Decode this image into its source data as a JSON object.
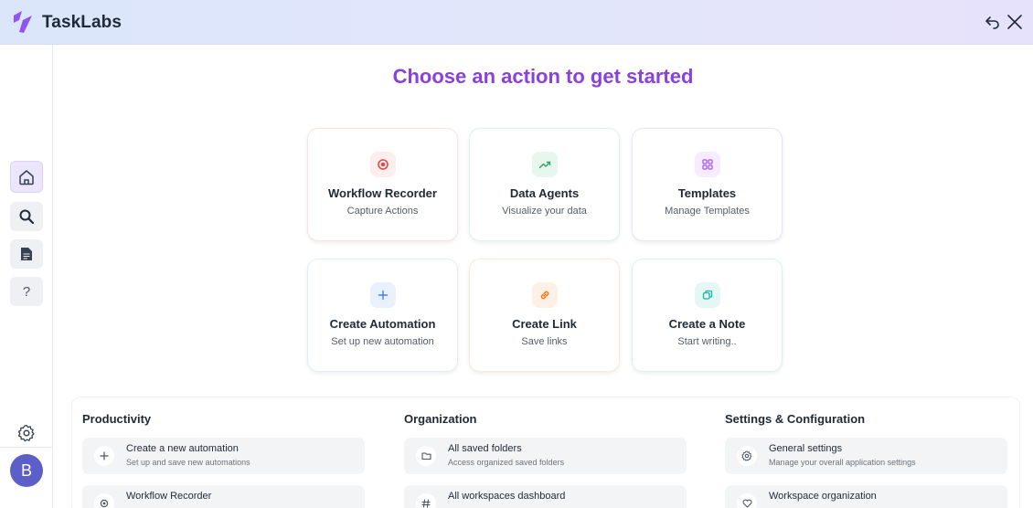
{
  "app": {
    "title": "TaskLabs"
  },
  "main": {
    "heading": "Choose an action to get started"
  },
  "sidebar": {
    "help_label": "?",
    "avatar_initial": "B"
  },
  "cards": [
    {
      "title": "Workflow Recorder",
      "subtitle": "Capture Actions",
      "icon": "record-icon",
      "accent": "#e5484d"
    },
    {
      "title": "Data Agents",
      "subtitle": "Visualize your data",
      "icon": "trending-up-icon",
      "accent": "#30a46c"
    },
    {
      "title": "Templates",
      "subtitle": "Manage Templates",
      "icon": "grid-icon",
      "accent": "#a855f7"
    },
    {
      "title": "Create Automation",
      "subtitle": "Set up new automation",
      "icon": "plus-icon",
      "accent": "#3b82f6"
    },
    {
      "title": "Create Link",
      "subtitle": "Save links",
      "icon": "link-icon",
      "accent": "#f97316"
    },
    {
      "title": "Create a Note",
      "subtitle": "Start writing..",
      "icon": "copy-icon",
      "accent": "#14b8a6"
    }
  ],
  "sections": [
    {
      "title": "Productivity",
      "items": [
        {
          "title": "Create a new automation",
          "subtitle": "Set up and save new automations",
          "icon": "plus-icon"
        },
        {
          "title": "Workflow Recorder",
          "subtitle": "",
          "icon": "record-icon"
        }
      ]
    },
    {
      "title": "Organization",
      "items": [
        {
          "title": "All saved folders",
          "subtitle": "Access organized saved folders",
          "icon": "folder-icon"
        },
        {
          "title": "All workspaces dashboard",
          "subtitle": "",
          "icon": "hash-icon"
        }
      ]
    },
    {
      "title": "Settings & Configuration",
      "items": [
        {
          "title": "General settings",
          "subtitle": "Manage your overall application settings",
          "icon": "gear-icon"
        },
        {
          "title": "Workspace organization",
          "subtitle": "",
          "icon": "heart-icon"
        }
      ]
    }
  ]
}
